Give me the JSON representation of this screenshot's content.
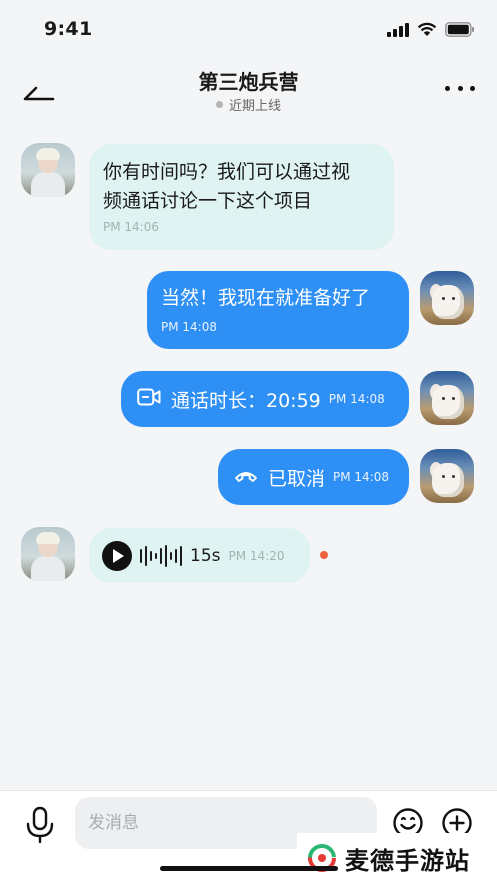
{
  "status_bar": {
    "time": "9:41"
  },
  "header": {
    "title": "第三炮兵营",
    "status": "近期上线"
  },
  "messages": [
    {
      "direction": "incoming",
      "type": "text",
      "lines": [
        "你有时间吗？我们可以通过视",
        "频通话讨论一下这个项目"
      ],
      "time": "PM 14:06"
    },
    {
      "direction": "outgoing",
      "type": "text",
      "text": "当然！我现在就准备好了",
      "time": "PM 14:08"
    },
    {
      "direction": "outgoing",
      "type": "video-call",
      "text": "通话时长：20:59",
      "time": "PM 14:08",
      "icon": "video-camera-icon"
    },
    {
      "direction": "outgoing",
      "type": "call-cancelled",
      "text": "已取消",
      "time": "PM 14:08",
      "icon": "hang-up-icon"
    },
    {
      "direction": "incoming",
      "type": "voice",
      "duration": "15s",
      "time": "PM 14:20",
      "unread": true
    }
  ],
  "input_bar": {
    "placeholder": "发消息"
  },
  "watermark": {
    "text": "麦德手游站"
  },
  "colors": {
    "outgoing_bubble": "#2e8ff5",
    "incoming_bubble": "#dff3f2",
    "unread_dot": "#f0603e",
    "background": "#f4f5f7"
  }
}
